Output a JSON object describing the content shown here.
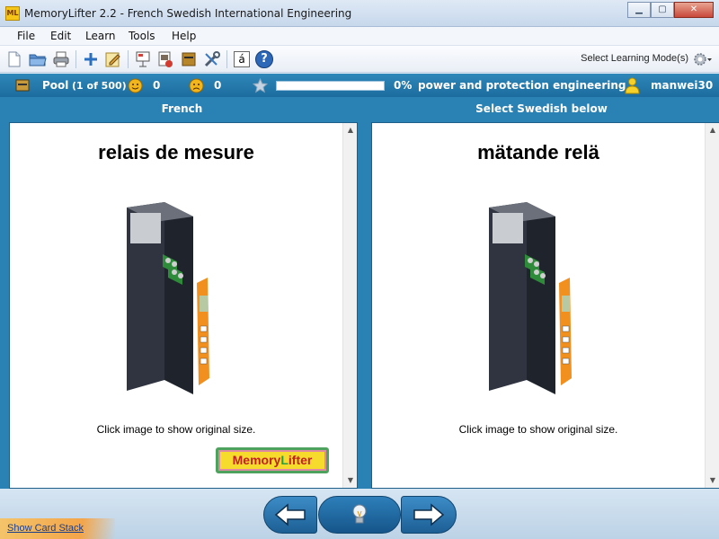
{
  "window": {
    "app_icon": "ML",
    "title": "MemoryLifter 2.2 - French Swedish International Engineering",
    "minimize_icon": "minimize-icon",
    "maximize_icon": "maximize-icon",
    "close_icon": "close-icon"
  },
  "menu": {
    "items": [
      {
        "label": "File"
      },
      {
        "label": "Edit"
      },
      {
        "label": "Learn"
      },
      {
        "label": "Tools"
      },
      {
        "label": "Help"
      }
    ]
  },
  "toolbar": {
    "icons": [
      "new-document-icon",
      "open-folder-icon",
      "print-icon",
      "add-icon",
      "edit-icon",
      "presentation-icon",
      "card-stack-icon",
      "dictionary-icon",
      "tools-icon",
      "special-characters-icon",
      "help-icon"
    ],
    "char_button_label": "á",
    "help_label": "?",
    "learning_mode_label": "Select Learning Mode(s)"
  },
  "status": {
    "pool_label": "Pool",
    "pool_count": "(1 of 500)",
    "happy_count": "0",
    "sad_count": "0",
    "progress_percent": 0,
    "progress_text": "0%",
    "chapter": "power and protection engineering",
    "user": "manwei30",
    "colors": {
      "bar": "#2577aa",
      "progress_bg": "#ffffff"
    }
  },
  "question": {
    "header": "French",
    "word": "relais de mesure",
    "caption": "Click image to show original size.",
    "logo_text_a": "Memory",
    "logo_text_b": "L",
    "logo_text_c": "ifter"
  },
  "answer": {
    "header": "Select Swedish below",
    "word": "mätande relä",
    "caption": "Click image to show original size."
  },
  "navigation": {
    "back_icon": "arrow-left-icon",
    "hint_icon": "lightbulb-icon",
    "next_icon": "arrow-right-icon"
  },
  "footer": {
    "card_stack_link": "Show Card Stack"
  }
}
